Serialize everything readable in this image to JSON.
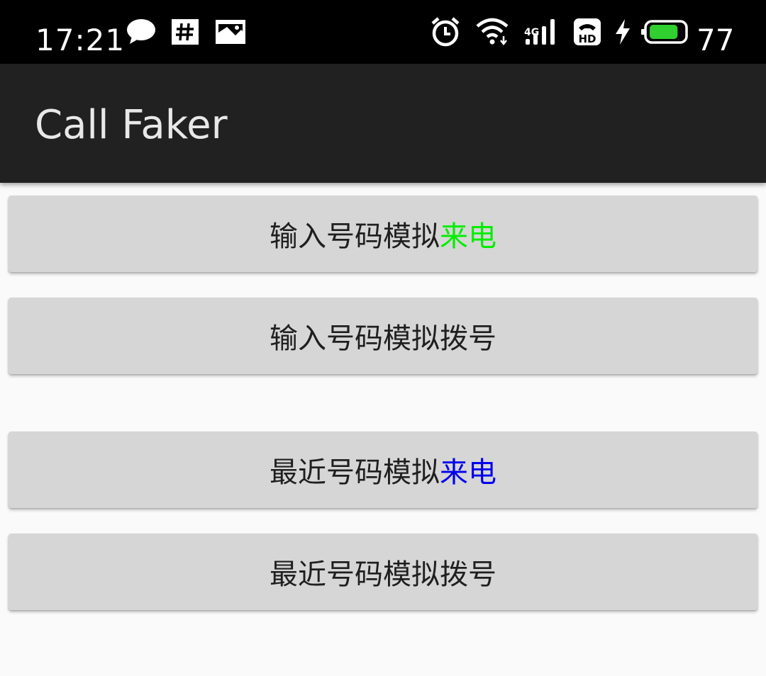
{
  "status_bar": {
    "time": "17:21",
    "network_label": "4G",
    "battery_level": "77",
    "battery_fraction": 0.77,
    "icons": [
      "chat-icon",
      "hashtag-icon",
      "image-icon",
      "alarm-icon",
      "wifi-icon",
      "signal-icon",
      "hd-call-icon",
      "charging-icon",
      "battery-icon"
    ]
  },
  "app_bar": {
    "title": "Call Faker"
  },
  "buttons": [
    {
      "label_main": "输入号码模拟",
      "label_accent": "来电",
      "accent_color": "#00ee00"
    },
    {
      "label_main": "输入号码模拟拨号",
      "label_accent": "",
      "accent_color": ""
    },
    {
      "label_main": "最近号码模拟",
      "label_accent": "来电",
      "accent_color": "#0000ee"
    },
    {
      "label_main": "最近号码模拟拨号",
      "label_accent": "",
      "accent_color": ""
    }
  ]
}
